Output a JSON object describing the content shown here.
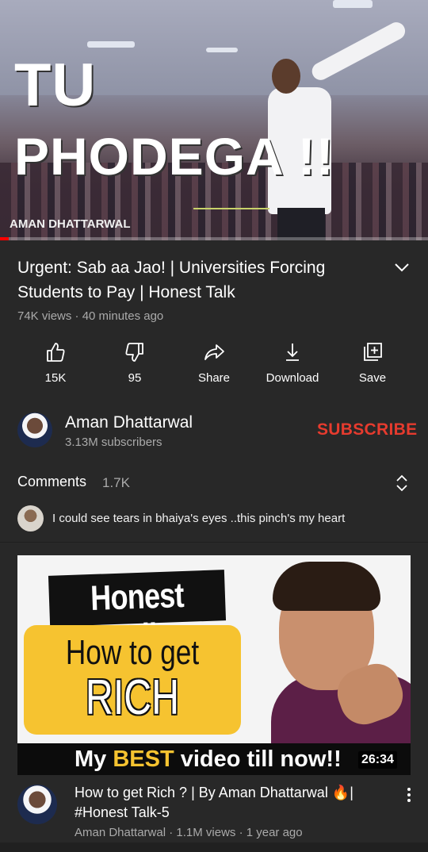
{
  "player": {
    "thumb_line1": "TU",
    "thumb_line2": "PHODEGA !!",
    "watermark": "AMAN DHATTARWAL",
    "progress_fraction": 0.02
  },
  "video": {
    "title": "Urgent: Sab aa Jao! | Universities Forcing Students to Pay | Honest Talk",
    "meta": "74K views · 40 minutes ago"
  },
  "actions": [
    {
      "label": "15K",
      "icon": "thumbs-up-icon"
    },
    {
      "label": "95",
      "icon": "thumbs-down-icon"
    },
    {
      "label": "Share",
      "icon": "share-icon"
    },
    {
      "label": "Download",
      "icon": "download-icon"
    },
    {
      "label": "Save",
      "icon": "add-to-playlist-icon"
    }
  ],
  "channel": {
    "name": "Aman Dhattarwal",
    "subscribers": "3.13M subscribers",
    "subscribe_label": "SUBSCRIBE"
  },
  "comments": {
    "heading": "Comments",
    "count": "1.7K",
    "top_comment": "I could see tears in bhaiya's eyes ..this pinch's my heart"
  },
  "recommended": {
    "thumb_tag": "Honest Talk",
    "thumb_line1": "How to get",
    "thumb_line2": "RICH",
    "thumb_bottom_pre": "My ",
    "thumb_bottom_hl": "BEST",
    "thumb_bottom_post": " video till now!!",
    "duration": "26:34",
    "title": "How to get Rich ? | By Aman Dhattarwal 🔥| #Honest Talk-5",
    "meta": "Aman Dhattarwal · 1.1M views · 1 year ago"
  },
  "colors": {
    "background": "#282828",
    "subscribe": "#e63b2e",
    "progress": "#ff0000",
    "secondary_text": "#aaaaaa",
    "thumb_yellow": "#f6c330"
  }
}
